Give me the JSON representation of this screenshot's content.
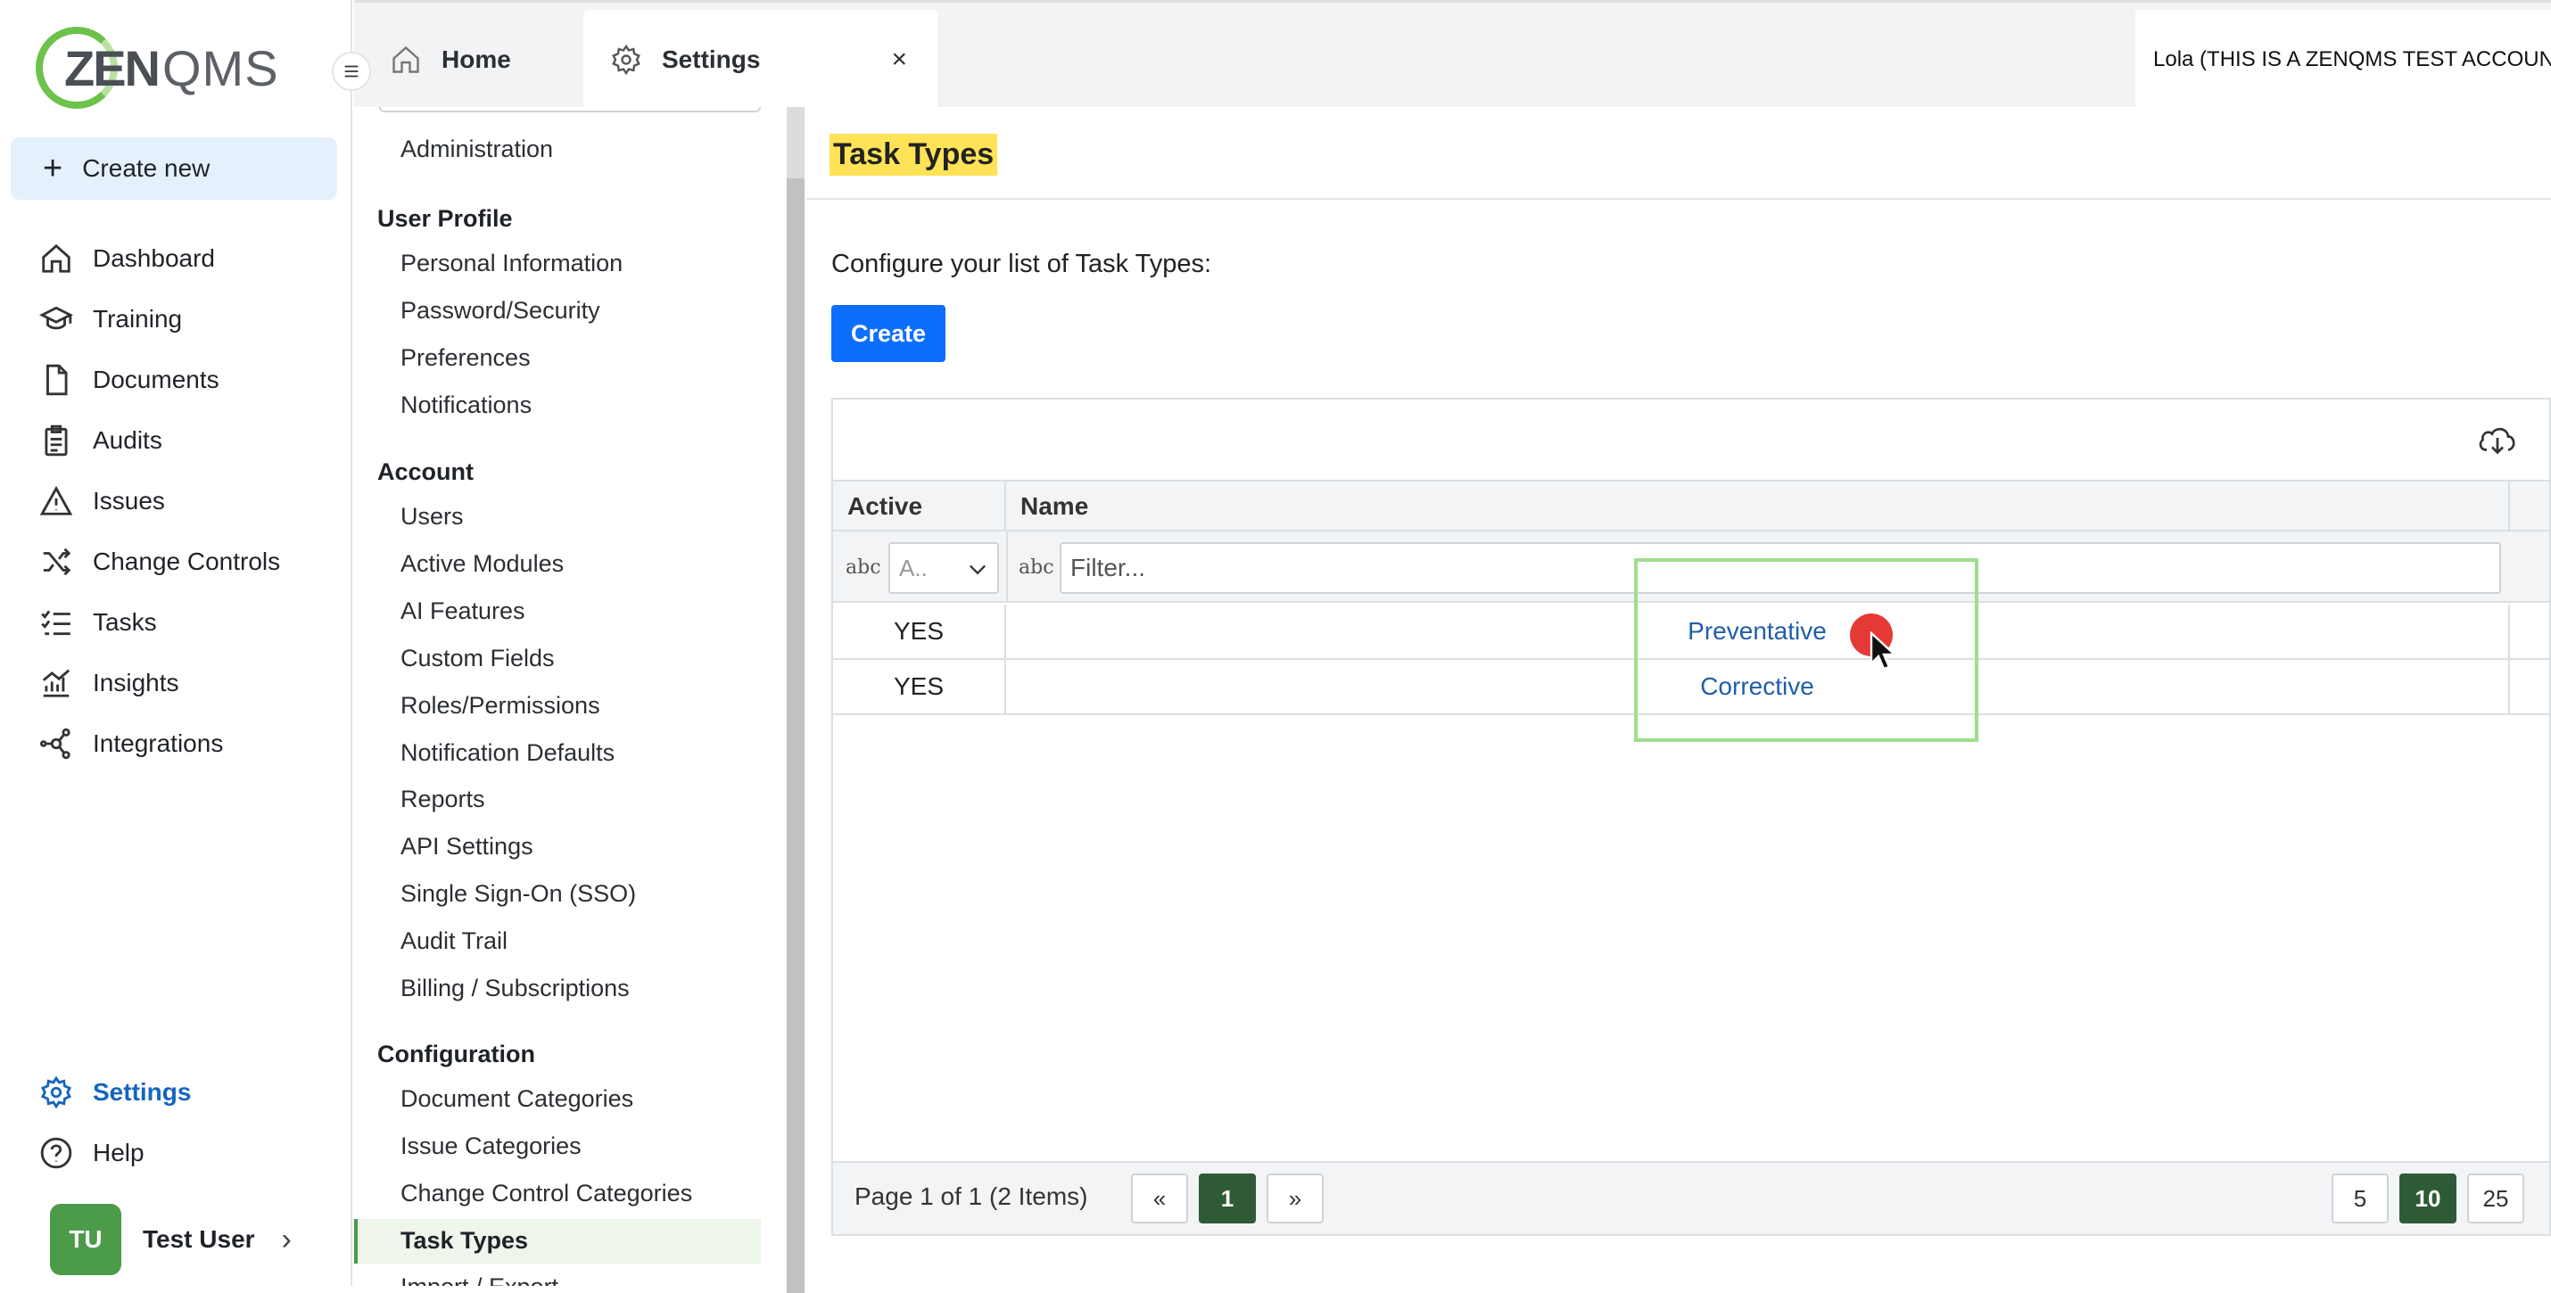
{
  "app": {
    "logo_text": "ZENQMS",
    "logo_part1": "ZEN",
    "logo_part2": "QMS"
  },
  "sidebar": {
    "create_label": "Create new",
    "items": [
      {
        "label": "Dashboard",
        "icon": "home-icon"
      },
      {
        "label": "Training",
        "icon": "graduation-cap-icon"
      },
      {
        "label": "Documents",
        "icon": "document-icon"
      },
      {
        "label": "Audits",
        "icon": "clipboard-icon"
      },
      {
        "label": "Issues",
        "icon": "warning-icon"
      },
      {
        "label": "Change Controls",
        "icon": "shuffle-icon"
      },
      {
        "label": "Tasks",
        "icon": "task-list-icon"
      },
      {
        "label": "Insights",
        "icon": "chart-icon"
      },
      {
        "label": "Integrations",
        "icon": "network-icon"
      }
    ],
    "settings_label": "Settings",
    "help_label": "Help",
    "user": {
      "initials": "TU",
      "name": "Test User"
    }
  },
  "tabs": {
    "home": "Home",
    "settings": "Settings",
    "close_glyph": "×"
  },
  "account_label": "Lola (THIS IS A ZENQMS TEST ACCOUNT)",
  "submenu": {
    "administration": "Administration",
    "user_profile_heading": "User Profile",
    "user_profile_items": [
      "Personal Information",
      "Password/Security",
      "Preferences",
      "Notifications"
    ],
    "account_heading": "Account",
    "account_items": [
      "Users",
      "Active Modules",
      "AI Features",
      "Custom Fields",
      "Roles/Permissions",
      "Notification Defaults",
      "Reports",
      "API Settings",
      "Single Sign-On (SSO)",
      "Audit Trail",
      "Billing / Subscriptions"
    ],
    "configuration_heading": "Configuration",
    "configuration_items": [
      "Document Categories",
      "Issue Categories",
      "Change Control Categories",
      "Task Types",
      "Import / Export"
    ]
  },
  "main": {
    "title": "Task Types",
    "configure_text": "Configure your list of Task Types:",
    "create_label": "Create",
    "grid": {
      "columns": {
        "active": "Active",
        "name": "Name"
      },
      "filter": {
        "abc_glyph": "abc",
        "active_placeholder": "A..",
        "name_placeholder": "Filter..."
      },
      "rows": [
        {
          "active": "YES",
          "name": "Preventative"
        },
        {
          "active": "YES",
          "name": "Corrective"
        }
      ],
      "pager": {
        "info": "Page 1 of 1 (2 Items)",
        "prev": "«",
        "current": "1",
        "next": "»",
        "sizes": [
          "5",
          "10",
          "25"
        ],
        "selected_size": "10"
      }
    }
  },
  "colors": {
    "accent_blue": "#0d6efd",
    "brand_green": "#4b9b49",
    "title_highlight": "#ffe357",
    "link_blue": "#1f5ea8"
  }
}
